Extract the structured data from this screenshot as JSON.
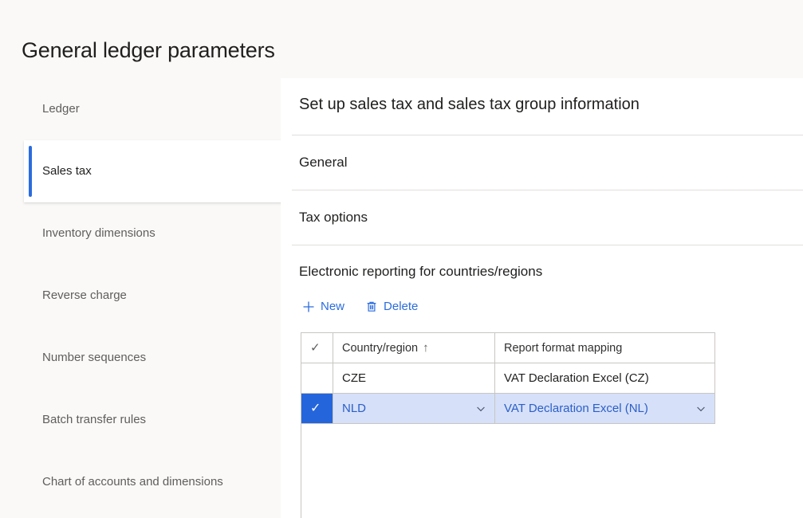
{
  "page": {
    "title": "General ledger parameters"
  },
  "sidebar": {
    "items": [
      {
        "label": "Ledger",
        "selected": false
      },
      {
        "label": "Sales tax",
        "selected": true
      },
      {
        "label": "Inventory dimensions",
        "selected": false
      },
      {
        "label": "Reverse charge",
        "selected": false
      },
      {
        "label": "Number sequences",
        "selected": false
      },
      {
        "label": "Batch transfer rules",
        "selected": false
      },
      {
        "label": "Chart of accounts and dimensions",
        "selected": false
      }
    ]
  },
  "content": {
    "title": "Set up sales tax and sales tax group information",
    "sections": [
      {
        "title": "General",
        "expanded": false
      },
      {
        "title": "Tax options",
        "expanded": false
      },
      {
        "title": "Electronic reporting for countries/regions",
        "expanded": true
      }
    ],
    "toolbar": {
      "new_label": "New",
      "new_icon": "plus-icon",
      "delete_label": "Delete",
      "delete_icon": "trash-icon"
    },
    "grid": {
      "select_all_icon": "checkmark-icon",
      "columns": [
        {
          "label": "Country/region",
          "sort": "↑"
        },
        {
          "label": "Report format mapping",
          "sort": ""
        }
      ],
      "rows": [
        {
          "selected": false,
          "country": "CZE",
          "mapping": "VAT Declaration Excel (CZ)"
        },
        {
          "selected": true,
          "country": "NLD",
          "mapping": "VAT Declaration Excel (NL)"
        }
      ]
    }
  },
  "colors": {
    "accent": "#2b6cde",
    "selected_cell": "#2565dc",
    "selected_row_bg": "#d6e0f8",
    "page_bg": "#faf9f8",
    "panel_bg": "#ffffff",
    "grid_border": "#c8c6c4"
  }
}
